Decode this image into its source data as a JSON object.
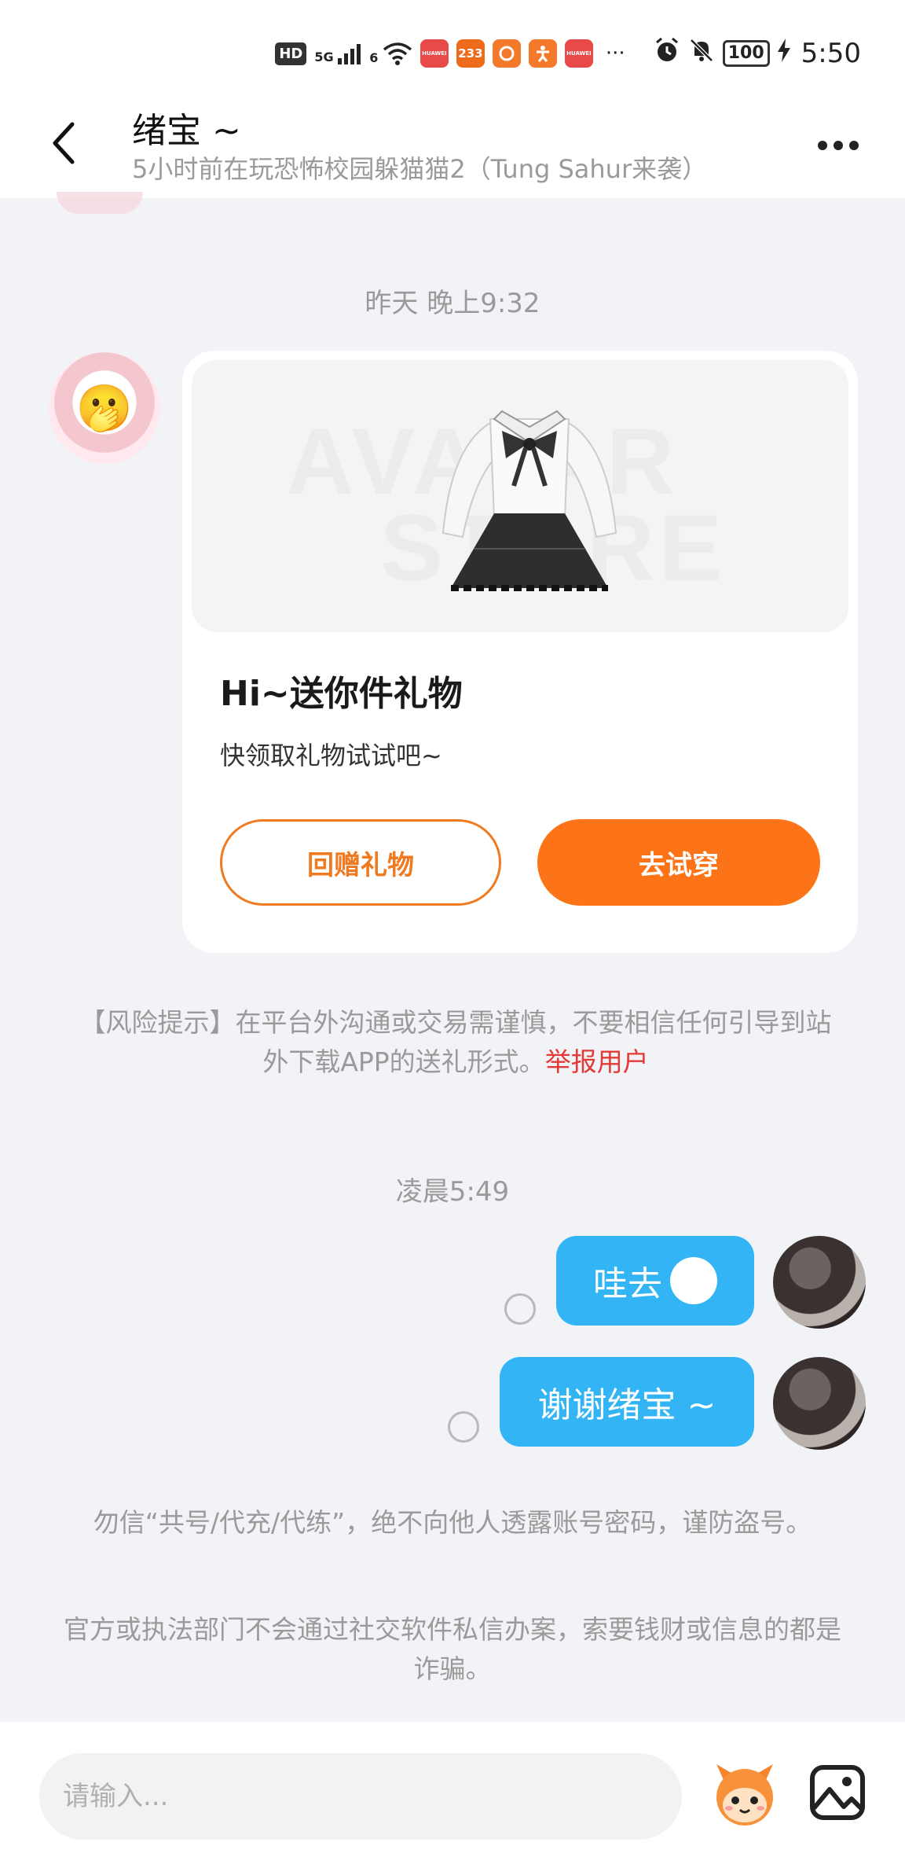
{
  "status_bar": {
    "hd_label": "HD",
    "network_label": "5G",
    "wifi_label": "6",
    "app_icons": [
      {
        "label": "HUAWEI",
        "color": "#e84a4a"
      },
      {
        "label": "233",
        "color": "#f06a1c"
      },
      {
        "label": "",
        "color": "#f4792a"
      },
      {
        "label": "",
        "color": "#f4792a"
      },
      {
        "label": "HUAWEI",
        "color": "#e84a4a"
      }
    ],
    "more_label": "···",
    "battery": "100",
    "time": "5:50"
  },
  "header": {
    "title": "绪宝 ~",
    "subtitle": "5小时前在玩恐怖校园躲猫猫2（Tung Sahur来袭）"
  },
  "messages": {
    "timestamp_1": "昨天 晚上9:32",
    "gift_card": {
      "watermark_1": "AVATAR",
      "watermark_2": "STORE",
      "title": "Hi~送你件礼物",
      "subtitle": "快领取礼物试试吧~",
      "return_gift_label": "回赠礼物",
      "try_on_label": "去试穿"
    },
    "risk_note": "【风险提示】在平台外沟通或交易需谨慎，不要相信任何引导到站外下载APP的送礼形式。",
    "report_label": "举报用户",
    "timestamp_2": "凌晨5:49",
    "outgoing": [
      {
        "text": "哇去",
        "emoji": "😱"
      },
      {
        "text": "谢谢绪宝 ~"
      }
    ],
    "safety_note_1": "勿信“共号/代充/代练”，绝不向他人透露账号密码，谨防盗号。",
    "safety_note_2": "官方或执法部门不会通过社交软件私信办案，索要钱财或信息的都是诈骗。"
  },
  "input_bar": {
    "placeholder": "请输入..."
  },
  "colors": {
    "accent_orange": "#fc7417",
    "bubble_blue": "#33b5f5",
    "report_red": "#e53935"
  }
}
